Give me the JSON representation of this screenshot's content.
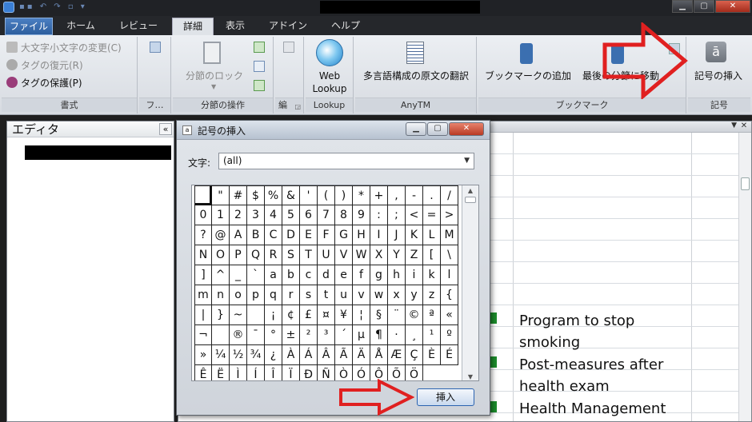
{
  "ribbon_tabs": [
    {
      "label": "ファイル"
    },
    {
      "label": "ホーム"
    },
    {
      "label": "レビュー"
    },
    {
      "label": "詳細"
    },
    {
      "label": "表示"
    },
    {
      "label": "アドイン"
    },
    {
      "label": "ヘルプ"
    }
  ],
  "ribbon": {
    "format": {
      "items": [
        "大文字小文字の変更(C)",
        "タグの復元(R)",
        "タグの保護(P)"
      ],
      "label": "書式"
    },
    "fu_group": {
      "label": "フ…"
    },
    "segment_ops": {
      "lock_label": "分節のロック",
      "label": "分節の操作"
    },
    "edit_group": {
      "label": "編"
    },
    "lookup": {
      "button_label_1": "Web",
      "button_label_2": "Lookup",
      "label": "Lookup"
    },
    "anytm": {
      "button_label": "多言語構成の原文の翻訳",
      "label": "AnyTM"
    },
    "bookmark": {
      "add_label": "ブックマークの追加",
      "move_label": "最後の分節に移動",
      "label": "ブックマーク"
    },
    "symbol": {
      "insert_label": "記号の挿入",
      "label": "記号"
    }
  },
  "editor": {
    "title": "エディタ"
  },
  "segments": [
    "Program to stop",
    "smoking",
    "Post-measures after",
    "health exam",
    "Health Management"
  ],
  "dialog": {
    "title": "記号の挿入",
    "char_label": "文字:",
    "char_value": "(all)",
    "insert_label": "挿入",
    "chars": [
      "",
      "\"",
      "#",
      "$",
      "%",
      "&",
      "'",
      "(",
      ")",
      "*",
      "+",
      ",",
      "-",
      ".",
      "/",
      "0",
      "1",
      "2",
      "3",
      "4",
      "5",
      "6",
      "7",
      "8",
      "9",
      ":",
      ";",
      "<",
      "=",
      ">",
      "?",
      "@",
      "A",
      "B",
      "C",
      "D",
      "E",
      "F",
      "G",
      "H",
      "I",
      "J",
      "K",
      "L",
      "M",
      "N",
      "O",
      "P",
      "Q",
      "R",
      "S",
      "T",
      "U",
      "V",
      "W",
      "X",
      "Y",
      "Z",
      "[",
      "\\",
      "]",
      "^",
      "_",
      "`",
      "a",
      "b",
      "c",
      "d",
      "e",
      "f",
      "g",
      "h",
      "i",
      "k",
      "l",
      "m",
      "n",
      "o",
      "p",
      "q",
      "r",
      "s",
      "t",
      "u",
      "v",
      "w",
      "x",
      "y",
      "z",
      "{",
      "|",
      "}",
      "~",
      "",
      "¡",
      "¢",
      "£",
      "¤",
      "¥",
      "¦",
      "§",
      "¨",
      "©",
      "ª",
      "«",
      "¬",
      "",
      "®",
      "¯",
      "°",
      "±",
      "²",
      "³",
      "´",
      "µ",
      "¶",
      "·",
      "¸",
      "¹",
      "º",
      "»",
      "¼",
      "½",
      "¾",
      "¿",
      "À",
      "Á",
      "Â",
      "Ã",
      "Ä",
      "Å",
      "Æ",
      "Ç",
      "È",
      "É",
      "Ê",
      "Ë",
      "Ì",
      "Í",
      "Î",
      "Ï",
      "Ð",
      "Ñ",
      "Ò",
      "Ó",
      "Ô",
      "Õ",
      "Ö"
    ]
  },
  "colors": {
    "arrow": "#e02020",
    "segment_marker": "#1c8b2b"
  }
}
